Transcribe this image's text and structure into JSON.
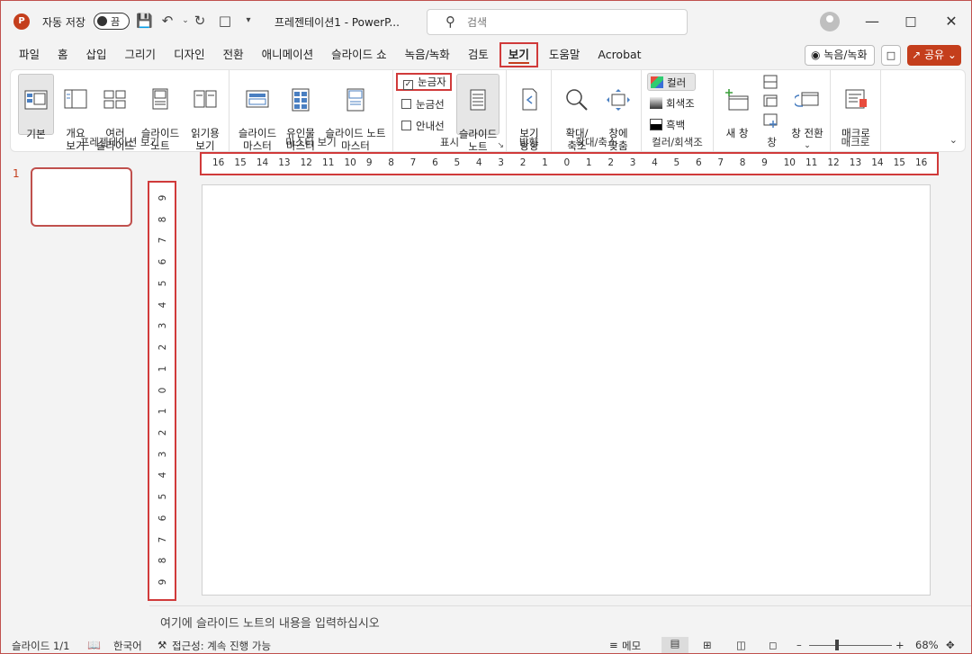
{
  "titlebar": {
    "app_icon": "powerpoint-logo",
    "autosave_label": "자동 저장",
    "autosave_state": "끔",
    "doc_title": "프레젠테이션1 - PowerP...",
    "search_placeholder": "검색",
    "controls": [
      "minimize-icon",
      "maximize-icon",
      "close-icon"
    ]
  },
  "tabs": [
    {
      "label": "파일"
    },
    {
      "label": "홈"
    },
    {
      "label": "삽입"
    },
    {
      "label": "그리기"
    },
    {
      "label": "디자인"
    },
    {
      "label": "전환"
    },
    {
      "label": "애니메이션"
    },
    {
      "label": "슬라이드 쇼"
    },
    {
      "label": "녹음/녹화"
    },
    {
      "label": "검토"
    },
    {
      "label": "보기",
      "active": true
    },
    {
      "label": "도움말"
    },
    {
      "label": "Acrobat"
    }
  ],
  "right_buttons": {
    "record": "녹음/녹화",
    "share": "공유"
  },
  "ribbon": {
    "presentation_views": {
      "label": "프레젠테이션 보기",
      "normal": "기본",
      "outline": "개요\n보기",
      "sorter": "여러\n슬라이드",
      "notes_page": "슬라이드\n노트",
      "reading": "읽기용\n보기"
    },
    "master_views": {
      "label": "마스터 보기",
      "slide_master": "슬라이드\n마스터",
      "handout_master": "유인물\n마스터",
      "notes_master": "슬라이드 노트\n마스터"
    },
    "show": {
      "label": "표시",
      "ruler": "눈금자",
      "gridlines": "눈금선",
      "guides": "안내선",
      "notes": "슬라이드\n노트"
    },
    "orientation": {
      "label": "방향",
      "button": "보기\n방향"
    },
    "zoom": {
      "label": "확대/축소",
      "zoom": "확대/\n축소",
      "fit": "창에\n맞춤"
    },
    "color": {
      "label": "컬러/회색조",
      "color": "컬러",
      "grayscale": "회색조",
      "bw": "흑백"
    },
    "window": {
      "label": "창",
      "new_window": "새 창",
      "switch": "창 전환"
    },
    "macros": {
      "label": "매크로",
      "button": "매크로"
    }
  },
  "slide_pane": {
    "number": "1"
  },
  "ruler_h": [
    "16",
    "15",
    "14",
    "13",
    "12",
    "11",
    "10",
    "9",
    "8",
    "7",
    "6",
    "5",
    "4",
    "3",
    "2",
    "1",
    "0",
    "1",
    "2",
    "3",
    "4",
    "5",
    "6",
    "7",
    "8",
    "9",
    "10",
    "11",
    "12",
    "13",
    "14",
    "15",
    "16"
  ],
  "ruler_v": [
    "9",
    "8",
    "7",
    "6",
    "5",
    "4",
    "3",
    "2",
    "1",
    "0",
    "1",
    "2",
    "3",
    "4",
    "5",
    "6",
    "7",
    "8",
    "9"
  ],
  "notes_placeholder": "여기에 슬라이드 노트의 내용을 입력하십시오",
  "statusbar": {
    "slide": "슬라이드 1/1",
    "language": "한국어",
    "accessibility": "접근성: 계속 진행 가능",
    "notes": "메모",
    "zoom": "68%"
  }
}
